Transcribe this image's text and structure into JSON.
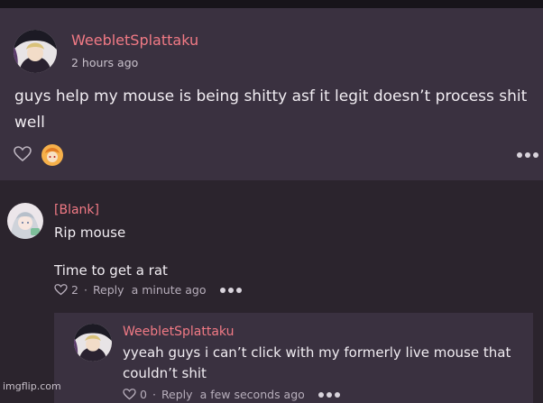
{
  "post": {
    "username": "WeebletSplattaku",
    "time": "2 hours ago",
    "text_line1": "guys help my mouse is being shitty asf it legit doesn’t process shit",
    "text_line2": "well",
    "icons": [
      "heart-outline-icon",
      "reaction-avatar-icon",
      "more-icon"
    ]
  },
  "comment": {
    "username": "[Blank]",
    "line1": "Rip mouse",
    "line2": "Time to get a rat",
    "like_count": "2",
    "reply_label": "Reply",
    "time": "a minute ago"
  },
  "reply": {
    "username": "WeebletSplattaku",
    "line1": "yyeah guys i can’t click with my formerly live mouse that",
    "line2": "couldn’t shit",
    "like_count": "0",
    "reply_label": "Reply",
    "time": "a few seconds ago"
  },
  "watermark": "imgflip.com",
  "colors": {
    "username": "#f17a85",
    "post_bg": "#3a3140",
    "page_bg": "#2b242d"
  }
}
